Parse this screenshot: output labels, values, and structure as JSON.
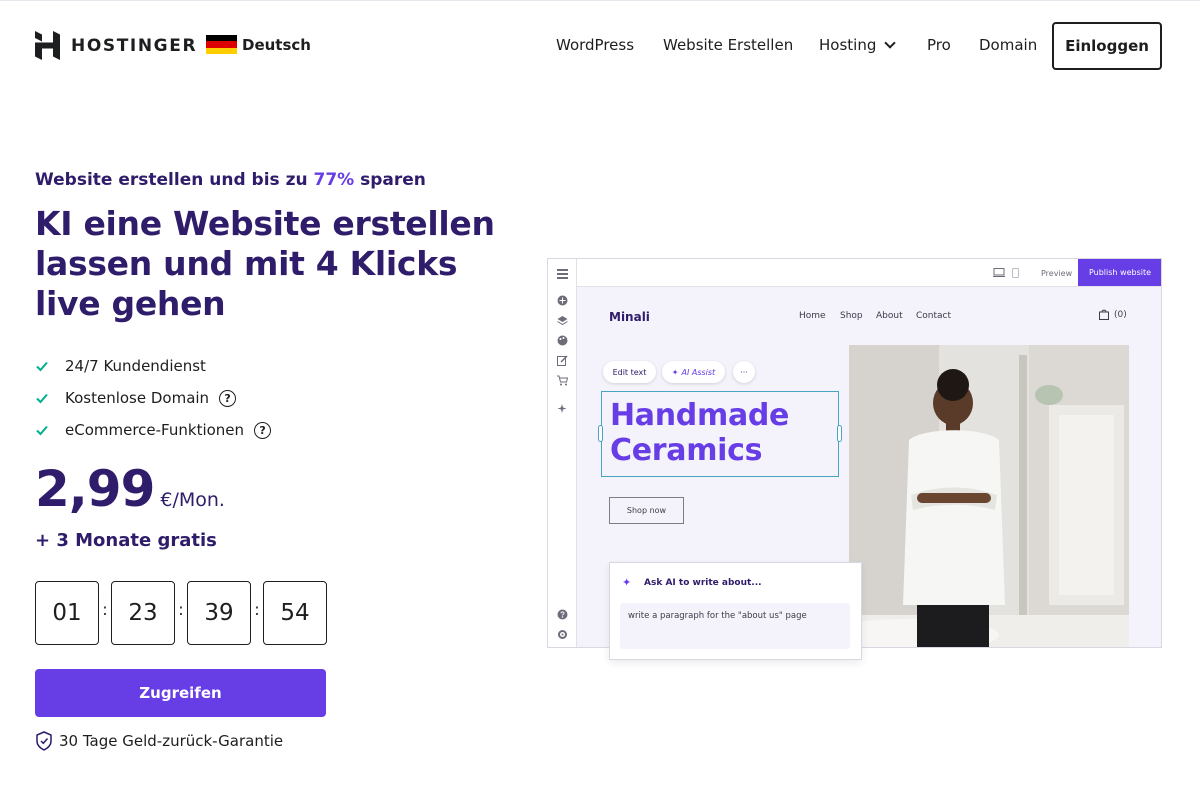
{
  "header": {
    "logo_text": "HOSTINGER",
    "language": "Deutsch",
    "nav": [
      "WordPress",
      "Website Erstellen",
      "Hosting",
      "Pro",
      "Domain"
    ],
    "login_label": "Einloggen"
  },
  "hero": {
    "promo_prefix": "Website erstellen und bis zu ",
    "promo_highlight": "77%",
    "promo_suffix": " sparen",
    "headline": "KI eine Website erstellen lassen und mit 4 Klicks live gehen",
    "features": [
      {
        "label": "24/7 Kundendienst"
      },
      {
        "label": "Kostenlose Domain"
      },
      {
        "label": "eCommerce-Funktionen"
      }
    ],
    "help_glyph": "?",
    "price_value": "2,99",
    "price_unit": "€/Mon.",
    "bonus": "+ 3 Monate gratis",
    "countdown": [
      "01",
      "23",
      "39",
      "54"
    ],
    "timer_separator": ":",
    "cta_label": "Zugreifen",
    "guarantee": "30 Tage Geld-zurück-Garantie"
  },
  "builder": {
    "preview_label": "Preview",
    "publish_label": "Publish website",
    "site_logo": "Minali",
    "site_nav": [
      "Home",
      "Shop",
      "About",
      "Contact"
    ],
    "cart_label": "(0)",
    "chip_edit": "Edit text",
    "chip_ai": "AI Assist",
    "chip_more": "···",
    "hero_line1": "Handmade",
    "hero_line2": "Ceramics",
    "shop_button": "Shop now",
    "ai_title": "Ask AI to write about...",
    "ai_prompt": "write a paragraph for the \"about us\" page"
  },
  "colors": {
    "brand_purple": "#673de6",
    "text_dark": "#2f1c6a",
    "check_green": "#00b090",
    "selection_blue": "#4aa3c2"
  },
  "icons": [
    "hostinger-logo-icon",
    "germany-flag-icon",
    "chevron-down-icon",
    "check-icon",
    "help-icon",
    "shield-check-icon",
    "sparkle-icon",
    "cart-icon"
  ]
}
